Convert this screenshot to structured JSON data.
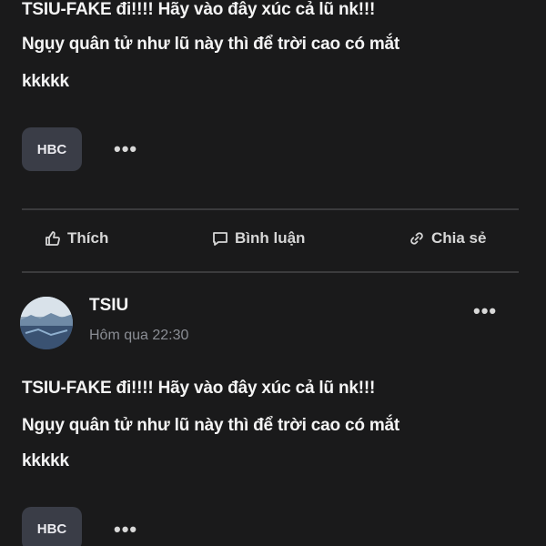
{
  "post_top": {
    "lines": [
      "TSIU-FAKE đi!!!! Hãy vào đây xúc cả lũ nk!!!",
      "Ngụy quân tử như lũ này thì để trời cao có mắt",
      "kkkkk"
    ],
    "tag": "HBC",
    "more": "•••"
  },
  "actions": {
    "like": "Thích",
    "comment": "Bình luận",
    "share": "Chia sẻ"
  },
  "post_bottom": {
    "author": "TSIU",
    "time": "Hôm qua 22:30",
    "more": "•••",
    "lines": [
      "TSIU-FAKE đi!!!! Hãy vào đây xúc cả lũ nk!!!",
      "Ngụy quân tử như lũ này thì để trời cao có mắt",
      "kkkkk"
    ],
    "tag": "HBC",
    "tag_more": "•••"
  },
  "icons": {
    "like": "thumbs-up-icon",
    "comment": "comment-bubble-icon",
    "share": "link-icon",
    "more": "more-horizontal-icon"
  },
  "colors": {
    "background": "#1a1a1b",
    "chip": "#3a3d47",
    "divider": "#3b3b3d",
    "muted_text": "#8a8d94"
  }
}
